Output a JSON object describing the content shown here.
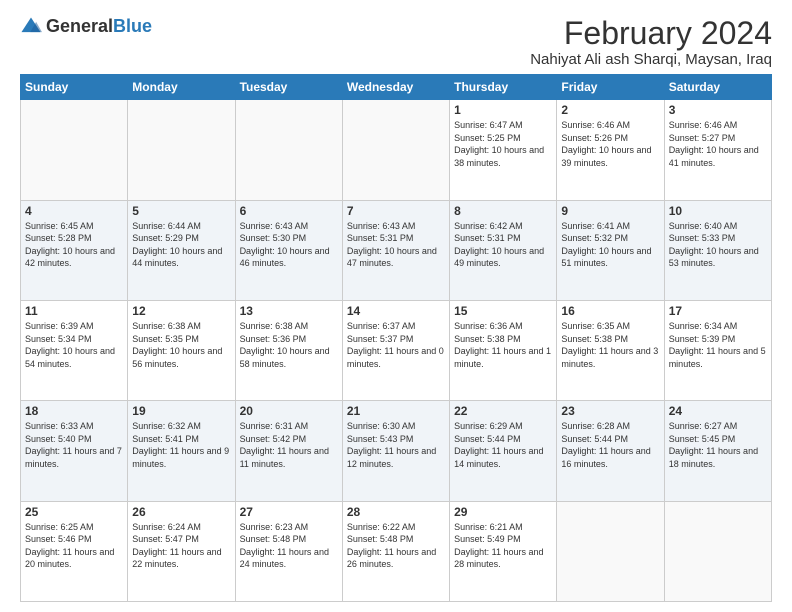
{
  "header": {
    "logo_general": "General",
    "logo_blue": "Blue",
    "month_year": "February 2024",
    "location": "Nahiyat Ali ash Sharqi, Maysan, Iraq"
  },
  "days_of_week": [
    "Sunday",
    "Monday",
    "Tuesday",
    "Wednesday",
    "Thursday",
    "Friday",
    "Saturday"
  ],
  "weeks": [
    [
      {
        "day": "",
        "info": ""
      },
      {
        "day": "",
        "info": ""
      },
      {
        "day": "",
        "info": ""
      },
      {
        "day": "",
        "info": ""
      },
      {
        "day": "1",
        "info": "Sunrise: 6:47 AM\nSunset: 5:25 PM\nDaylight: 10 hours\nand 38 minutes."
      },
      {
        "day": "2",
        "info": "Sunrise: 6:46 AM\nSunset: 5:26 PM\nDaylight: 10 hours\nand 39 minutes."
      },
      {
        "day": "3",
        "info": "Sunrise: 6:46 AM\nSunset: 5:27 PM\nDaylight: 10 hours\nand 41 minutes."
      }
    ],
    [
      {
        "day": "4",
        "info": "Sunrise: 6:45 AM\nSunset: 5:28 PM\nDaylight: 10 hours\nand 42 minutes."
      },
      {
        "day": "5",
        "info": "Sunrise: 6:44 AM\nSunset: 5:29 PM\nDaylight: 10 hours\nand 44 minutes."
      },
      {
        "day": "6",
        "info": "Sunrise: 6:43 AM\nSunset: 5:30 PM\nDaylight: 10 hours\nand 46 minutes."
      },
      {
        "day": "7",
        "info": "Sunrise: 6:43 AM\nSunset: 5:31 PM\nDaylight: 10 hours\nand 47 minutes."
      },
      {
        "day": "8",
        "info": "Sunrise: 6:42 AM\nSunset: 5:31 PM\nDaylight: 10 hours\nand 49 minutes."
      },
      {
        "day": "9",
        "info": "Sunrise: 6:41 AM\nSunset: 5:32 PM\nDaylight: 10 hours\nand 51 minutes."
      },
      {
        "day": "10",
        "info": "Sunrise: 6:40 AM\nSunset: 5:33 PM\nDaylight: 10 hours\nand 53 minutes."
      }
    ],
    [
      {
        "day": "11",
        "info": "Sunrise: 6:39 AM\nSunset: 5:34 PM\nDaylight: 10 hours\nand 54 minutes."
      },
      {
        "day": "12",
        "info": "Sunrise: 6:38 AM\nSunset: 5:35 PM\nDaylight: 10 hours\nand 56 minutes."
      },
      {
        "day": "13",
        "info": "Sunrise: 6:38 AM\nSunset: 5:36 PM\nDaylight: 10 hours\nand 58 minutes."
      },
      {
        "day": "14",
        "info": "Sunrise: 6:37 AM\nSunset: 5:37 PM\nDaylight: 11 hours\nand 0 minutes."
      },
      {
        "day": "15",
        "info": "Sunrise: 6:36 AM\nSunset: 5:38 PM\nDaylight: 11 hours\nand 1 minute."
      },
      {
        "day": "16",
        "info": "Sunrise: 6:35 AM\nSunset: 5:38 PM\nDaylight: 11 hours\nand 3 minutes."
      },
      {
        "day": "17",
        "info": "Sunrise: 6:34 AM\nSunset: 5:39 PM\nDaylight: 11 hours\nand 5 minutes."
      }
    ],
    [
      {
        "day": "18",
        "info": "Sunrise: 6:33 AM\nSunset: 5:40 PM\nDaylight: 11 hours\nand 7 minutes."
      },
      {
        "day": "19",
        "info": "Sunrise: 6:32 AM\nSunset: 5:41 PM\nDaylight: 11 hours\nand 9 minutes."
      },
      {
        "day": "20",
        "info": "Sunrise: 6:31 AM\nSunset: 5:42 PM\nDaylight: 11 hours\nand 11 minutes."
      },
      {
        "day": "21",
        "info": "Sunrise: 6:30 AM\nSunset: 5:43 PM\nDaylight: 11 hours\nand 12 minutes."
      },
      {
        "day": "22",
        "info": "Sunrise: 6:29 AM\nSunset: 5:44 PM\nDaylight: 11 hours\nand 14 minutes."
      },
      {
        "day": "23",
        "info": "Sunrise: 6:28 AM\nSunset: 5:44 PM\nDaylight: 11 hours\nand 16 minutes."
      },
      {
        "day": "24",
        "info": "Sunrise: 6:27 AM\nSunset: 5:45 PM\nDaylight: 11 hours\nand 18 minutes."
      }
    ],
    [
      {
        "day": "25",
        "info": "Sunrise: 6:25 AM\nSunset: 5:46 PM\nDaylight: 11 hours\nand 20 minutes."
      },
      {
        "day": "26",
        "info": "Sunrise: 6:24 AM\nSunset: 5:47 PM\nDaylight: 11 hours\nand 22 minutes."
      },
      {
        "day": "27",
        "info": "Sunrise: 6:23 AM\nSunset: 5:48 PM\nDaylight: 11 hours\nand 24 minutes."
      },
      {
        "day": "28",
        "info": "Sunrise: 6:22 AM\nSunset: 5:48 PM\nDaylight: 11 hours\nand 26 minutes."
      },
      {
        "day": "29",
        "info": "Sunrise: 6:21 AM\nSunset: 5:49 PM\nDaylight: 11 hours\nand 28 minutes."
      },
      {
        "day": "",
        "info": ""
      },
      {
        "day": "",
        "info": ""
      }
    ]
  ]
}
